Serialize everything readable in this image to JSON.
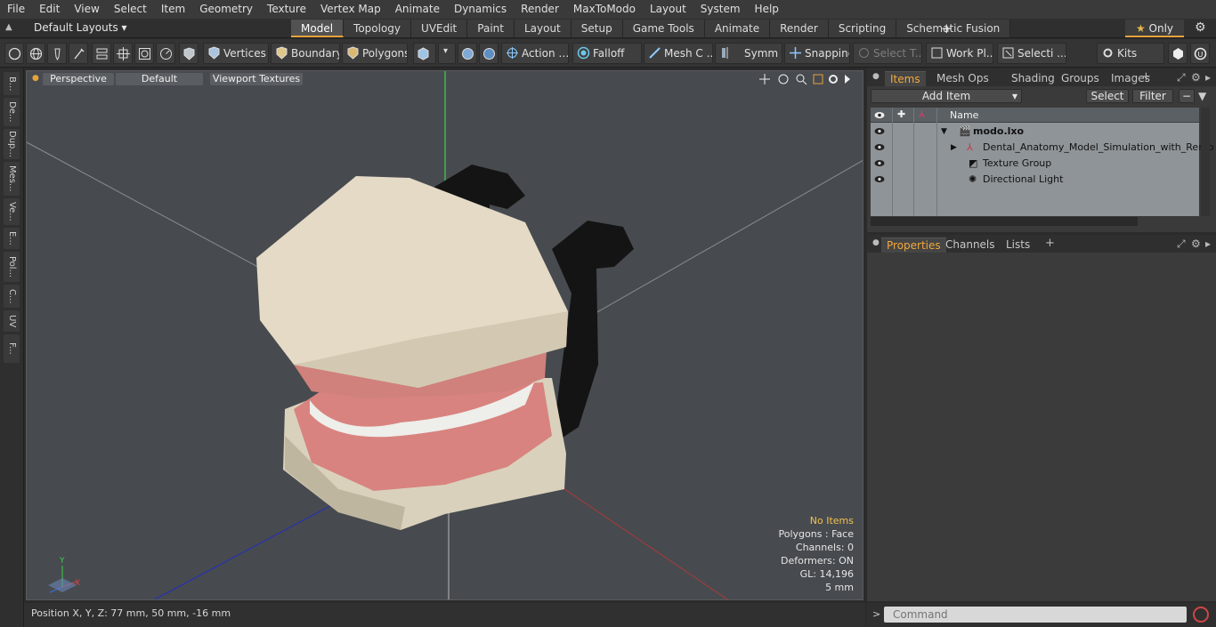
{
  "menu": [
    "File",
    "Edit",
    "View",
    "Select",
    "Item",
    "Geometry",
    "Texture",
    "Vertex Map",
    "Animate",
    "Dynamics",
    "Render",
    "MaxToModo",
    "Layout",
    "System",
    "Help"
  ],
  "layout_selector": "Default Layouts",
  "tabs": [
    {
      "label": "Model",
      "active": true
    },
    {
      "label": "Topology"
    },
    {
      "label": "UVEdit"
    },
    {
      "label": "Paint"
    },
    {
      "label": "Layout"
    },
    {
      "label": "Setup"
    },
    {
      "label": "Game Tools"
    },
    {
      "label": "Animate"
    },
    {
      "label": "Render"
    },
    {
      "label": "Scripting"
    },
    {
      "label": "Schematic Fusion"
    }
  ],
  "only_label": "Only",
  "toolbar": {
    "vertices": "Vertices",
    "boundary": "Boundary",
    "polygons": "Polygons",
    "action": "Action",
    "falloff": "Falloff",
    "mesh": "Mesh C ...",
    "symmetry": "Symm ...",
    "snapping": "Snapping",
    "select_t": "Select T...",
    "work_plane": "Work Pl...",
    "selection": "Selecti ...",
    "kits": "Kits"
  },
  "left_tabs": [
    "B...",
    "De...",
    "Dup...",
    "Mes...",
    "Ve...",
    "E...",
    "Pol...",
    "C...",
    "UV",
    "F..."
  ],
  "viewport": {
    "view": "Perspective",
    "shading": "Default",
    "textures": "Viewport Textures",
    "info": {
      "no_items": "No Items",
      "polygons": "Polygons : Face",
      "channels": "Channels: 0",
      "deformers": "Deformers: ON",
      "gl": "GL: 14,196",
      "scale": "5 mm"
    }
  },
  "status": "Position X, Y, Z:  77 mm, 50 mm, -16 mm",
  "items_panel": {
    "tabs": [
      "Items",
      "Mesh Ops",
      "Shading",
      "Groups",
      "Images"
    ],
    "add_item": "Add Item",
    "select": "Select",
    "filter": "Filter",
    "name_col": "Name",
    "rows": [
      {
        "label": "modo.lxo",
        "bold": true
      },
      {
        "label": "Dental_Anatomy_Model_Simulation_with_Remo ..."
      },
      {
        "label": "Texture Group"
      },
      {
        "label": "Directional Light"
      }
    ]
  },
  "properties_panel": {
    "tabs": [
      "Properties",
      "Channels",
      "Lists"
    ]
  },
  "command_placeholder": "Command",
  "colors": {
    "accent": "#e6a23c",
    "viewport_bg": "#474b4f",
    "list_bg": "#8f9498"
  }
}
